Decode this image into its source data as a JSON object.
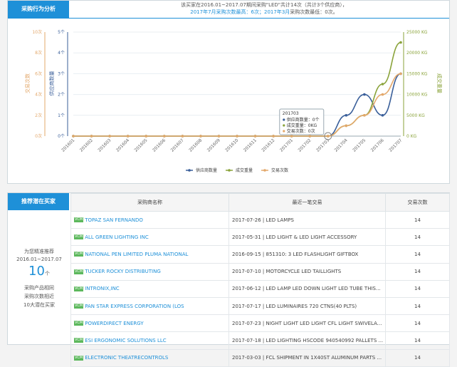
{
  "top": {
    "tab": "采购行为分析",
    "summary_line1": "该买家在2016.01~2017.07期间采购\"LED\"共计14次（共计3个供应商），",
    "summary_line2_a": "2017年7月",
    "summary_line2_b": "采购次数最高：6次；",
    "summary_line2_c": "2017年3月",
    "summary_line2_d": "采购次数最低：0次。"
  },
  "chart_data": {
    "type": "line",
    "categories": [
      "201601",
      "201602",
      "201603",
      "201604",
      "201605",
      "201606",
      "201607",
      "201608",
      "201609",
      "201610",
      "201611",
      "201612",
      "201701",
      "201702",
      "201703",
      "201704",
      "201705",
      "201706",
      "201707"
    ],
    "series": [
      {
        "name": "供应商数量",
        "color": "#3a5f9a",
        "axis": "left2",
        "values": [
          0,
          0,
          0,
          0,
          0,
          0,
          0,
          0,
          0,
          0,
          0,
          0,
          0,
          0,
          0,
          1,
          2,
          1,
          3
        ]
      },
      {
        "name": "成交重量",
        "color": "#8aa33a",
        "axis": "right",
        "values": [
          0,
          0,
          0,
          0,
          0,
          0,
          0,
          0,
          0,
          0,
          0,
          0,
          0,
          0,
          0,
          2500,
          5000,
          12500,
          22500
        ]
      },
      {
        "name": "交易次数",
        "color": "#e3a86b",
        "axis": "left1",
        "values": [
          0,
          0,
          0,
          0,
          0,
          0,
          0,
          0,
          0,
          0,
          0,
          0,
          0,
          0,
          0,
          1,
          2,
          4,
          6
        ]
      }
    ],
    "left1_ticks": [
      "0次",
      "2次",
      "4次",
      "6次",
      "8次",
      "10次"
    ],
    "left1_label": "交易次数",
    "left2_ticks": [
      "0个",
      "1个",
      "2个",
      "3个",
      "4个",
      "5个"
    ],
    "left2_label": "供应商数量",
    "right_ticks": [
      "0 KG",
      "5000 KG",
      "10000 KG",
      "15000 KG",
      "20000 KG",
      "25000 KG"
    ],
    "right_label": "成交重量",
    "ylim_left1": [
      0,
      10
    ],
    "ylim_left2": [
      0,
      5
    ],
    "ylim_right": [
      0,
      25000
    ],
    "legend_placement": "bottom-center",
    "tooltip": {
      "title": "201703",
      "rows": [
        "供应商数量：0个",
        "成交重量：0KG",
        "交易次数：0次"
      ]
    }
  },
  "bottom": {
    "tab": "推荐潜在买家",
    "left_text1": "为您精准推荐",
    "left_text2": "2016.01~2017.07",
    "left_count": "10",
    "left_unit": "个",
    "left_text3": "采购产品相同",
    "left_text4": "采购次数相近",
    "left_text5": "10大潜在买家",
    "headers": [
      "采购商名称",
      "最近一笔交易",
      "交易次数"
    ],
    "badge": "VCM",
    "rows": [
      {
        "name": "TOPAZ SAN FERNANDO",
        "trade": "2017-07-26 | LED LAMPS",
        "count": "14"
      },
      {
        "name": "ALL GREEN LIGHTING INC",
        "trade": "2017-05-31 | LED LIGHT & LED LIGHT ACCESSORY",
        "count": "14"
      },
      {
        "name": "NATIONAL PEN LIMITED PLUMA NATIONAL",
        "trade": "2016-09-15 | 851310: 3 LED FLASHLIGHT GIFTBOX",
        "count": "14"
      },
      {
        "name": "TUCKER ROCKY DISTRIBUTING",
        "trade": "2017-07-10 | MOTORCYCLE LED TAILLIGHTS",
        "count": "14"
      },
      {
        "name": "INTRONIX,INC",
        "trade": "2017-06-12 | LED LAMP LED DOWN LIGHT LED TUBE THIS...",
        "count": "14"
      },
      {
        "name": "PAN STAR EXPRESS CORPORATION (LOS",
        "trade": "2017-07-17 | LED LUMINAIRES 720 CTNS(40 PLTS)",
        "count": "14"
      },
      {
        "name": "POWERDIRECT ENERGY",
        "trade": "2017-07-23 | NIGHT LIGHT LED LIGHT CFL LIGHT SWIVELA...",
        "count": "14"
      },
      {
        "name": "ESI ERGONOMIC SOLUTIONS LLC",
        "trade": "2017-07-18 | LED LIGHTING HSCODE 940540992 PALLETS ...",
        "count": "14"
      },
      {
        "name": "ELECTRONIC THEATRECONTROLS",
        "trade": "2017-03-03 | FCL SHIPMENT IN 1X40ST ALUMINUM PARTS ...",
        "count": "14"
      }
    ]
  }
}
